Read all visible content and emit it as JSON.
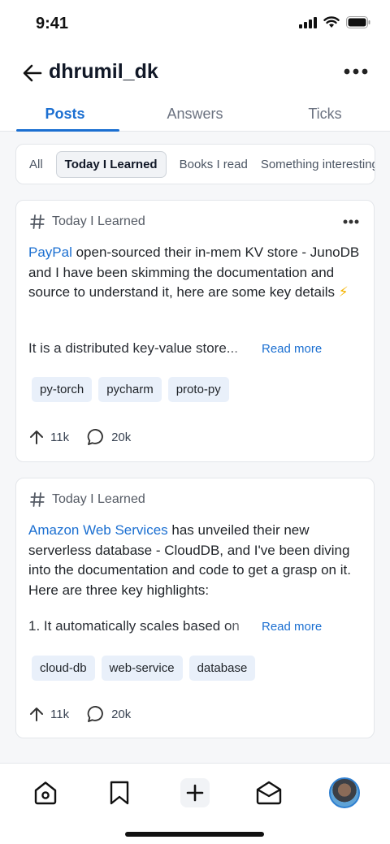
{
  "status": {
    "time": "9:41"
  },
  "header": {
    "title": "dhrumil_dk"
  },
  "tabs": [
    {
      "label": "Posts"
    },
    {
      "label": "Answers"
    },
    {
      "label": "Ticks"
    }
  ],
  "filters": [
    {
      "label": "All"
    },
    {
      "label": "Today I Learned"
    },
    {
      "label": "Books I read"
    },
    {
      "label": "Something interesting"
    }
  ],
  "posts": [
    {
      "category": "Today I Learned",
      "link_text": "PayPal",
      "body": " open-sourced their in-mem KV store - JunoDB and I have been skimming the documentation and source to understand it, here are some key details ",
      "emoji": "⚡",
      "excerpt": "It is a distributed key-value store...",
      "read_more": "Read more",
      "tags": [
        "py-torch",
        "pycharm",
        "proto-py"
      ],
      "upvotes": "11k",
      "comments": "20k"
    },
    {
      "category": "Today I Learned",
      "link_text": "Amazon Web Services",
      "body": " has unveiled their new serverless database - CloudDB, and I've been diving into the documentation and code to get a grasp on it. Here are three key highlights:",
      "emoji": "",
      "excerpt": "1. It automatically scales based on",
      "read_more": "Read more",
      "tags": [
        "cloud-db",
        "web-service",
        "database"
      ],
      "upvotes": "11k",
      "comments": "20k"
    }
  ],
  "colors": {
    "accent": "#1b6fd1",
    "tag_bg": "#e9f0fa"
  },
  "bottom_nav": [
    "home-icon",
    "bookmark-icon",
    "plus-icon",
    "inbox-icon",
    "avatar"
  ]
}
